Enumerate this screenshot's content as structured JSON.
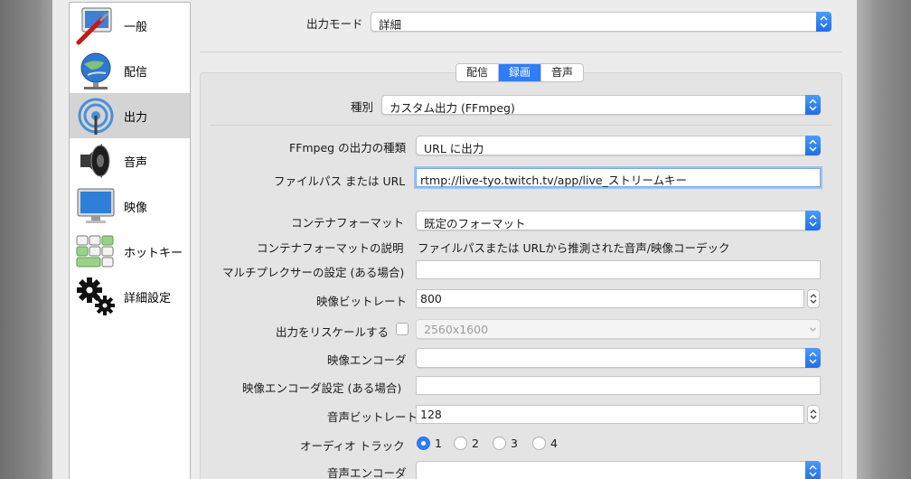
{
  "sidebar": {
    "items": [
      {
        "label": "一般",
        "icon": "general-icon"
      },
      {
        "label": "配信",
        "icon": "stream-icon"
      },
      {
        "label": "出力",
        "icon": "output-icon",
        "active": true
      },
      {
        "label": "音声",
        "icon": "audio-icon"
      },
      {
        "label": "映像",
        "icon": "video-icon"
      },
      {
        "label": "ホットキー",
        "icon": "hotkeys-icon"
      },
      {
        "label": "詳細設定",
        "icon": "advanced-icon"
      }
    ]
  },
  "output_mode": {
    "label": "出力モード",
    "value": "詳細"
  },
  "tabs": [
    {
      "label": "配信"
    },
    {
      "label": "録画",
      "active": true
    },
    {
      "label": "音声"
    }
  ],
  "recording": {
    "type": {
      "label": "種別",
      "value": "カスタム出力 (FFmpeg)"
    },
    "ffmpeg_output_type": {
      "label": "FFmpeg の出力の種類",
      "value": "URL に出力"
    },
    "file_path": {
      "label": "ファイルパス または URL",
      "value": "rtmp://live-tyo.twitch.tv/app/live_ストリームキー"
    },
    "container_format": {
      "label": "コンテナフォーマット",
      "value": "既定のフォーマット"
    },
    "container_desc": {
      "label": "コンテナフォーマットの説明",
      "value": "ファイルパスまたは URLから推測された音声/映像コーデック"
    },
    "muxer_settings": {
      "label": "マルチプレクサーの設定 (ある場合)",
      "value": ""
    },
    "video_bitrate": {
      "label": "映像ビットレート",
      "value": "800"
    },
    "rescale": {
      "label": "出力をリスケールする",
      "value": "2560x1600",
      "checked": false
    },
    "video_encoder": {
      "label": "映像エンコーダ",
      "value": ""
    },
    "video_encoder_settings": {
      "label": "映像エンコーダ設定 (ある場合)",
      "value": ""
    },
    "audio_bitrate": {
      "label": "音声ビットレート",
      "value": "128"
    },
    "audio_track": {
      "label": "オーディオ トラック",
      "options": [
        "1",
        "2",
        "3",
        "4"
      ],
      "selected": "1"
    },
    "audio_encoder": {
      "label": "音声エンコーダ",
      "value": ""
    }
  },
  "colors": {
    "accent": "#2e7cf6",
    "active_sidebar": "#d4d4d4"
  }
}
